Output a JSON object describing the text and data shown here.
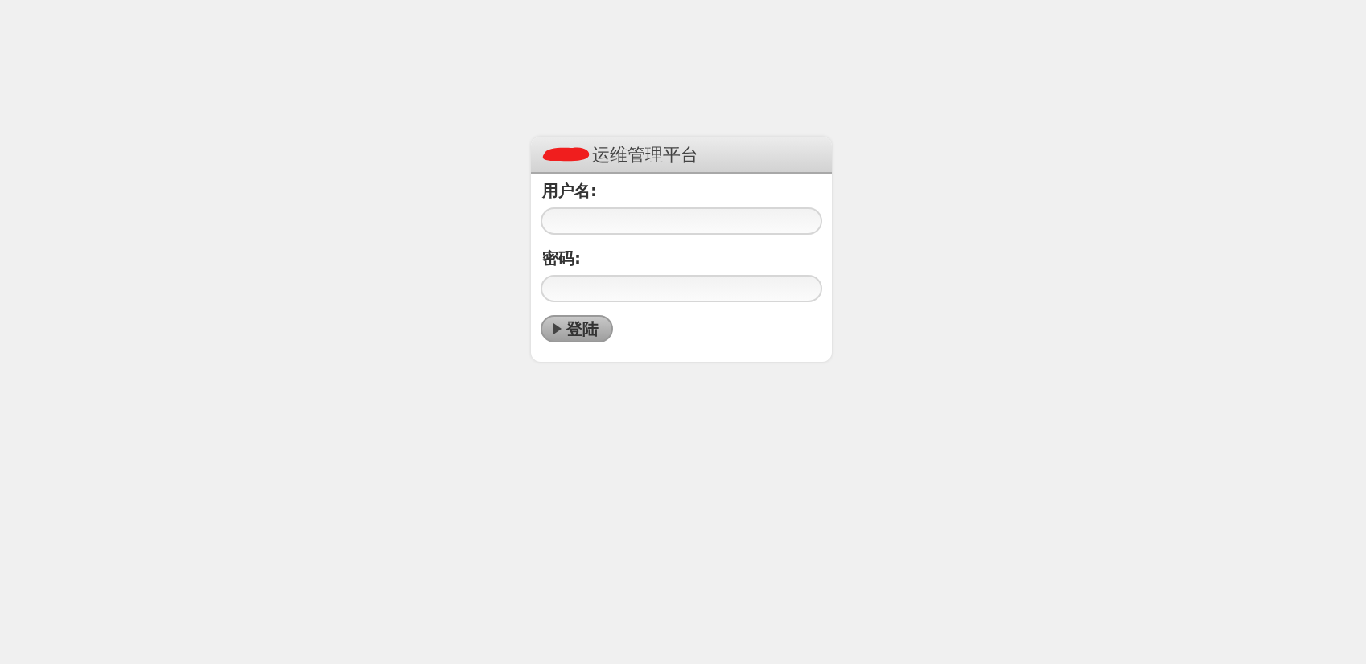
{
  "login_panel": {
    "title": "运维管理平台",
    "title_redacted": true,
    "fields": [
      {
        "label": "用户名:"
      },
      {
        "label": "密码:"
      }
    ],
    "submit": {
      "label": "登陆"
    }
  }
}
